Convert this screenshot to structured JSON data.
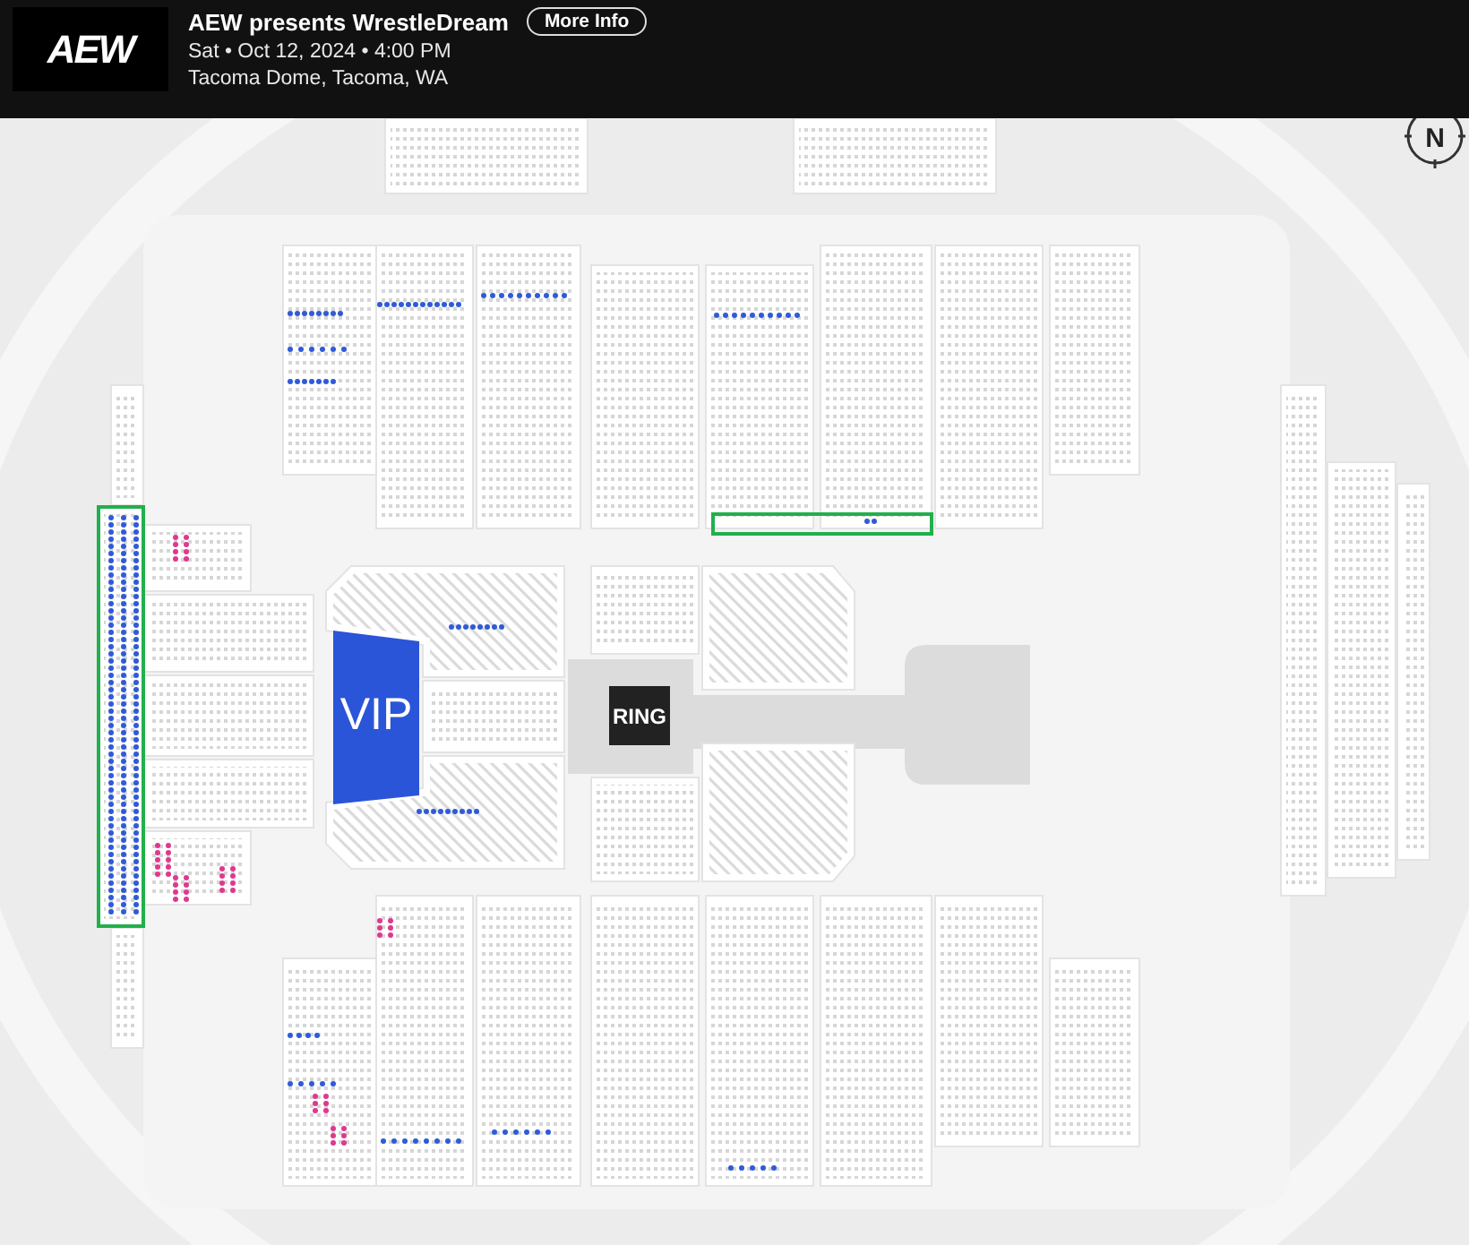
{
  "header": {
    "logo": "AEW",
    "title": "AEW presents WrestleDream",
    "more_info_button": "More Info",
    "date": "Sat • Oct 12, 2024 • 4:00 PM",
    "venue": "Tacoma Dome, Tacoma, WA"
  },
  "map": {
    "compass": "N",
    "vip_label": "VIP",
    "ring_label": "RING"
  }
}
